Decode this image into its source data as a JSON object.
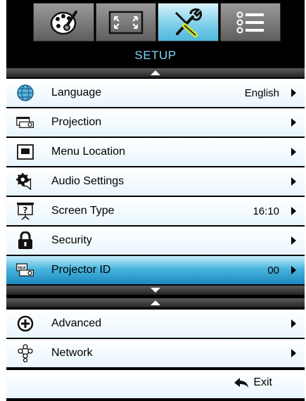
{
  "tabs": [
    {
      "icon": "palette-icon"
    },
    {
      "icon": "screen-resize-icon"
    },
    {
      "icon": "tools-icon",
      "active": true
    },
    {
      "icon": "list-menu-icon"
    }
  ],
  "title": "SETUP",
  "menu": [
    {
      "label": "Language",
      "value": "English",
      "icon": "globe-icon"
    },
    {
      "label": "Projection",
      "value": "",
      "icon": "projector-icon"
    },
    {
      "label": "Menu Location",
      "value": "",
      "icon": "menu-location-icon"
    },
    {
      "label": "Audio Settings",
      "value": "",
      "icon": "speaker-gear-icon"
    },
    {
      "label": "Screen Type",
      "value": "16:10",
      "icon": "screen-type-icon"
    },
    {
      "label": "Security",
      "value": "",
      "icon": "lock-icon"
    },
    {
      "label": "Projector ID",
      "value": "00",
      "icon": "projector-id-icon",
      "selected": true
    }
  ],
  "submenu": [
    {
      "label": "Advanced",
      "icon": "plus-circle-icon"
    },
    {
      "label": "Network",
      "icon": "network-icon"
    }
  ],
  "exit": {
    "label": "Exit",
    "icon": "return-arrow-icon"
  },
  "colors": {
    "title": "#7fd6f6",
    "selected_row": "#4ab6df",
    "row_bg": "#e9f6fd"
  }
}
